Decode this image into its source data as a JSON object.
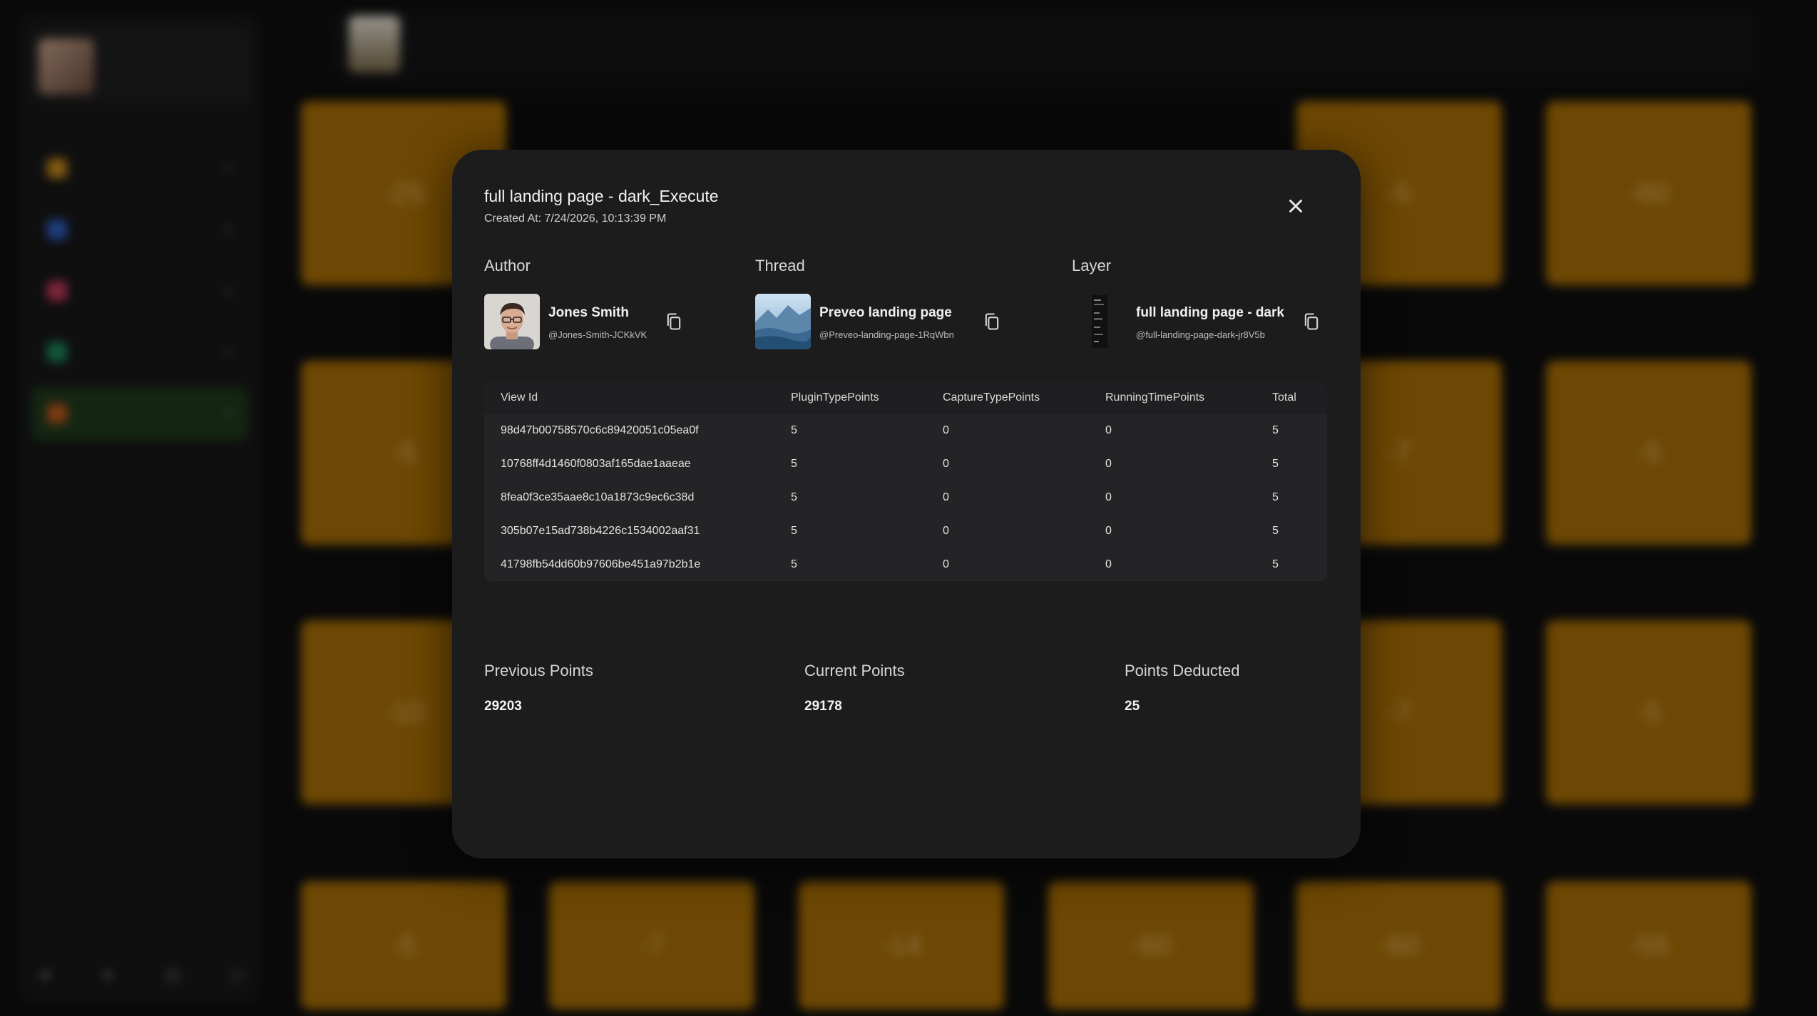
{
  "modal": {
    "title": "full landing page - dark_Execute",
    "created_at": "Created At: 7/24/2026, 10:13:39 PM",
    "sections": {
      "author": {
        "heading": "Author",
        "name": "Jones Smith",
        "handle": "@Jones-Smith-JCKkVK"
      },
      "thread": {
        "heading": "Thread",
        "name": "Preveo landing page",
        "handle": "@Preveo-landing-page-1RqWbn"
      },
      "layer": {
        "heading": "Layer",
        "name": "full landing page - dark",
        "handle": "@full-landing-page-dark-jr8V5b"
      }
    },
    "table": {
      "columns": [
        "View Id",
        "PluginTypePoints",
        "CaptureTypePoints",
        "RunningTimePoints",
        "Total"
      ],
      "rows": [
        [
          "98d47b00758570c6c89420051c05ea0f",
          "5",
          "0",
          "0",
          "5"
        ],
        [
          "10768ff4d1460f0803af165dae1aaeae",
          "5",
          "0",
          "0",
          "5"
        ],
        [
          "8fea0f3ce35aae8c10a1873c9ec6c38d",
          "5",
          "0",
          "0",
          "5"
        ],
        [
          "305b07e15ad738b4226c1534002aaf31",
          "5",
          "0",
          "0",
          "5"
        ],
        [
          "41798fb54dd60b97606be451a97b2b1e",
          "5",
          "0",
          "0",
          "5"
        ]
      ]
    },
    "points": {
      "previous_label": "Previous Points",
      "previous_value": "29203",
      "current_label": "Current Points",
      "current_value": "29178",
      "deducted_label": "Points Deducted",
      "deducted_value": "25"
    }
  },
  "background": {
    "tiles": [
      "-25",
      "-60",
      "-5",
      "-7",
      "-5",
      "-10",
      "-7",
      "-5",
      "-5",
      "-5",
      "-7",
      "-14",
      "-60",
      "-60",
      "-55"
    ],
    "accent_color": "#a86e06"
  },
  "icons": {
    "close": "close-icon",
    "copy": "copy-icon"
  }
}
